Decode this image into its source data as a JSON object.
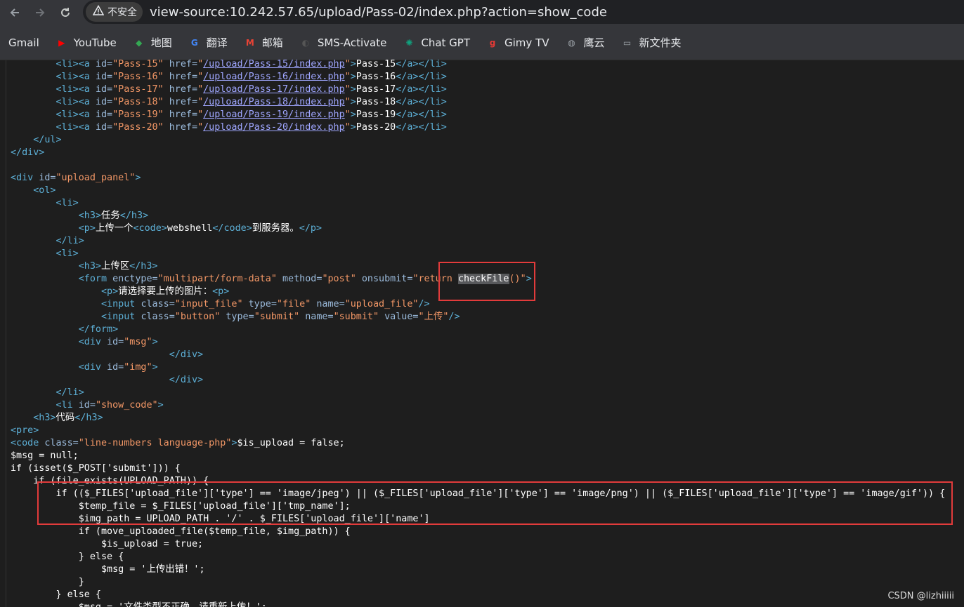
{
  "browser": {
    "back_icon": "back-arrow-icon",
    "forward_icon": "forward-arrow-icon",
    "reload_icon": "reload-icon",
    "security_label": "不安全",
    "url": "view-source:10.242.57.65/upload/Pass-02/index.php?action=show_code"
  },
  "bookmarks": [
    {
      "label": "Gmail",
      "icon": "gmail-icon",
      "color": "#ea4335",
      "glyph": "M"
    },
    {
      "label": "YouTube",
      "icon": "youtube-icon",
      "color": "#ff0000",
      "glyph": "▶"
    },
    {
      "label": "地图",
      "icon": "maps-icon",
      "color": "#34a853",
      "glyph": "◆"
    },
    {
      "label": "翻译",
      "icon": "translate-icon",
      "color": "#4285f4",
      "glyph": "G"
    },
    {
      "label": "邮箱",
      "icon": "mail-icon",
      "color": "#ea4335",
      "glyph": "M"
    },
    {
      "label": "SMS-Activate",
      "icon": "sms-activate-icon",
      "color": "#555555",
      "glyph": "◐"
    },
    {
      "label": "Chat GPT",
      "icon": "chatgpt-icon",
      "color": "#10a37f",
      "glyph": "✺"
    },
    {
      "label": "Gimy TV",
      "icon": "gimy-tv-icon",
      "color": "#e53935",
      "glyph": "g"
    },
    {
      "label": "鹰云",
      "icon": "globe-icon",
      "color": "#9aa0a6",
      "glyph": "◍"
    },
    {
      "label": "新文件夹",
      "icon": "folder-icon",
      "color": "#9aa0a6",
      "glyph": "▭"
    }
  ],
  "source_lines": [
    [
      [
        "t",
        "        "
      ],
      [
        "tag",
        "<li><a "
      ],
      [
        "attr",
        "id="
      ],
      [
        "val",
        "\"Pass-15\""
      ],
      [
        "attr",
        " href="
      ],
      [
        "val",
        "\""
      ],
      [
        "link",
        "/upload/Pass-15/index.php"
      ],
      [
        "val",
        "\""
      ],
      [
        "tag",
        ">"
      ],
      [
        "t",
        "Pass-15"
      ],
      [
        "tag",
        "</a></li>"
      ]
    ],
    [
      [
        "t",
        "        "
      ],
      [
        "tag",
        "<li><a "
      ],
      [
        "attr",
        "id="
      ],
      [
        "val",
        "\"Pass-16\""
      ],
      [
        "attr",
        " href="
      ],
      [
        "val",
        "\""
      ],
      [
        "link",
        "/upload/Pass-16/index.php"
      ],
      [
        "val",
        "\""
      ],
      [
        "tag",
        ">"
      ],
      [
        "t",
        "Pass-16"
      ],
      [
        "tag",
        "</a></li>"
      ]
    ],
    [
      [
        "t",
        "        "
      ],
      [
        "tag",
        "<li><a "
      ],
      [
        "attr",
        "id="
      ],
      [
        "val",
        "\"Pass-17\""
      ],
      [
        "attr",
        " href="
      ],
      [
        "val",
        "\""
      ],
      [
        "link",
        "/upload/Pass-17/index.php"
      ],
      [
        "val",
        "\""
      ],
      [
        "tag",
        ">"
      ],
      [
        "t",
        "Pass-17"
      ],
      [
        "tag",
        "</a></li>"
      ]
    ],
    [
      [
        "t",
        "        "
      ],
      [
        "tag",
        "<li><a "
      ],
      [
        "attr",
        "id="
      ],
      [
        "val",
        "\"Pass-18\""
      ],
      [
        "attr",
        " href="
      ],
      [
        "val",
        "\""
      ],
      [
        "link",
        "/upload/Pass-18/index.php"
      ],
      [
        "val",
        "\""
      ],
      [
        "tag",
        ">"
      ],
      [
        "t",
        "Pass-18"
      ],
      [
        "tag",
        "</a></li>"
      ]
    ],
    [
      [
        "t",
        "        "
      ],
      [
        "tag",
        "<li><a "
      ],
      [
        "attr",
        "id="
      ],
      [
        "val",
        "\"Pass-19\""
      ],
      [
        "attr",
        " href="
      ],
      [
        "val",
        "\""
      ],
      [
        "link",
        "/upload/Pass-19/index.php"
      ],
      [
        "val",
        "\""
      ],
      [
        "tag",
        ">"
      ],
      [
        "t",
        "Pass-19"
      ],
      [
        "tag",
        "</a></li>"
      ]
    ],
    [
      [
        "t",
        "        "
      ],
      [
        "tag",
        "<li><a "
      ],
      [
        "attr",
        "id="
      ],
      [
        "val",
        "\"Pass-20\""
      ],
      [
        "attr",
        " href="
      ],
      [
        "val",
        "\""
      ],
      [
        "link",
        "/upload/Pass-20/index.php"
      ],
      [
        "val",
        "\""
      ],
      [
        "tag",
        ">"
      ],
      [
        "t",
        "Pass-20"
      ],
      [
        "tag",
        "</a></li>"
      ]
    ],
    [
      [
        "t",
        "    "
      ],
      [
        "tag",
        "</ul>"
      ]
    ],
    [
      [
        "tag",
        "</div>"
      ]
    ],
    [
      [
        "t",
        ""
      ]
    ],
    [
      [
        "tag",
        "<div "
      ],
      [
        "attr",
        "id="
      ],
      [
        "val",
        "\"upload_panel\""
      ],
      [
        "tag",
        ">"
      ]
    ],
    [
      [
        "t",
        "    "
      ],
      [
        "tag",
        "<ol>"
      ]
    ],
    [
      [
        "t",
        "        "
      ],
      [
        "tag",
        "<li>"
      ]
    ],
    [
      [
        "t",
        "            "
      ],
      [
        "tag",
        "<h3>"
      ],
      [
        "t",
        "任务"
      ],
      [
        "tag",
        "</h3>"
      ]
    ],
    [
      [
        "t",
        "            "
      ],
      [
        "tag",
        "<p>"
      ],
      [
        "t",
        "上传一个"
      ],
      [
        "tag",
        "<code>"
      ],
      [
        "t",
        "webshell"
      ],
      [
        "tag",
        "</code>"
      ],
      [
        "t",
        "到服务器。"
      ],
      [
        "tag",
        "</p>"
      ]
    ],
    [
      [
        "t",
        "        "
      ],
      [
        "tag",
        "</li>"
      ]
    ],
    [
      [
        "t",
        "        "
      ],
      [
        "tag",
        "<li>"
      ]
    ],
    [
      [
        "t",
        "            "
      ],
      [
        "tag",
        "<h3>"
      ],
      [
        "t",
        "上传区"
      ],
      [
        "tag",
        "</h3>"
      ]
    ],
    [
      [
        "t",
        "            "
      ],
      [
        "tag",
        "<form "
      ],
      [
        "attr",
        "enctype="
      ],
      [
        "val",
        "\"multipart/form-data\""
      ],
      [
        "attr",
        " method="
      ],
      [
        "val",
        "\"post\""
      ],
      [
        "attr",
        " onsubmit="
      ],
      [
        "val",
        "\"return "
      ],
      [
        "hl",
        "checkFile"
      ],
      [
        "val",
        "()\""
      ],
      [
        "tag",
        ">"
      ]
    ],
    [
      [
        "t",
        "                "
      ],
      [
        "tag",
        "<p>"
      ],
      [
        "t",
        "请选择要上传的图片："
      ],
      [
        "tag",
        "<p>"
      ]
    ],
    [
      [
        "t",
        "                "
      ],
      [
        "tag",
        "<input "
      ],
      [
        "attr",
        "class="
      ],
      [
        "val",
        "\"input_file\""
      ],
      [
        "attr",
        " type="
      ],
      [
        "val",
        "\"file\""
      ],
      [
        "attr",
        " name="
      ],
      [
        "val",
        "\"upload_file\""
      ],
      [
        "tag",
        "/>"
      ]
    ],
    [
      [
        "t",
        "                "
      ],
      [
        "tag",
        "<input "
      ],
      [
        "attr",
        "class="
      ],
      [
        "val",
        "\"button\""
      ],
      [
        "attr",
        " type="
      ],
      [
        "val",
        "\"submit\""
      ],
      [
        "attr",
        " name="
      ],
      [
        "val",
        "\"submit\""
      ],
      [
        "attr",
        " value="
      ],
      [
        "val",
        "\"上传\""
      ],
      [
        "tag",
        "/>"
      ]
    ],
    [
      [
        "t",
        "            "
      ],
      [
        "tag",
        "</form>"
      ]
    ],
    [
      [
        "t",
        "            "
      ],
      [
        "tag",
        "<div "
      ],
      [
        "attr",
        "id="
      ],
      [
        "val",
        "\"msg\""
      ],
      [
        "tag",
        ">"
      ]
    ],
    [
      [
        "t",
        "                            "
      ],
      [
        "tag",
        "</div>"
      ]
    ],
    [
      [
        "t",
        "            "
      ],
      [
        "tag",
        "<div "
      ],
      [
        "attr",
        "id="
      ],
      [
        "val",
        "\"img\""
      ],
      [
        "tag",
        ">"
      ]
    ],
    [
      [
        "t",
        "                            "
      ],
      [
        "tag",
        "</div>"
      ]
    ],
    [
      [
        "t",
        "        "
      ],
      [
        "tag",
        "</li>"
      ]
    ],
    [
      [
        "t",
        "        "
      ],
      [
        "tag",
        "<li "
      ],
      [
        "attr",
        "id="
      ],
      [
        "val",
        "\"show_code\""
      ],
      [
        "tag",
        ">"
      ]
    ],
    [
      [
        "t",
        "    "
      ],
      [
        "tag",
        "<h3>"
      ],
      [
        "t",
        "代码"
      ],
      [
        "tag",
        "</h3>"
      ]
    ],
    [
      [
        "tag",
        "<pre>"
      ]
    ],
    [
      [
        "tag",
        "<code "
      ],
      [
        "attr",
        "class="
      ],
      [
        "val",
        "\"line-numbers language-php\""
      ],
      [
        "tag",
        ">"
      ],
      [
        "t",
        "$is_upload = false;"
      ]
    ],
    [
      [
        "t",
        "$msg = null;"
      ]
    ],
    [
      [
        "t",
        "if (isset($_POST['submit'])) {"
      ]
    ],
    [
      [
        "t",
        "    if (file_exists(UPLOAD_PATH)) {"
      ]
    ],
    [
      [
        "t",
        "        if (($_FILES['upload_file']['type'] == 'image/jpeg') || ($_FILES['upload_file']['type'] == 'image/png') || ($_FILES['upload_file']['type'] == 'image/gif')) {"
      ]
    ],
    [
      [
        "t",
        "            $temp_file = $_FILES['upload_file']['tmp_name'];"
      ]
    ],
    [
      [
        "t",
        "            $img_path = UPLOAD_PATH . '/' . $_FILES['upload_file']['name']"
      ]
    ],
    [
      [
        "t",
        "            if (move_uploaded_file($temp_file, $img_path)) {"
      ]
    ],
    [
      [
        "t",
        "                $is_upload = true;"
      ]
    ],
    [
      [
        "t",
        "            } else {"
      ]
    ],
    [
      [
        "t",
        "                $msg = '上传出错！';"
      ]
    ],
    [
      [
        "t",
        "            }"
      ]
    ],
    [
      [
        "t",
        "        } else {"
      ]
    ],
    [
      [
        "t",
        "            $msg = '文件类型不正确，请重新上传！';"
      ]
    ]
  ],
  "watermark": "CSDN @lizhiiiii",
  "accent_colors": {
    "tag": "#5db0d7",
    "attr": "#9bbbdc",
    "value": "#f29766",
    "link": "#9fa6ff",
    "annotation": "#e23b3b"
  }
}
